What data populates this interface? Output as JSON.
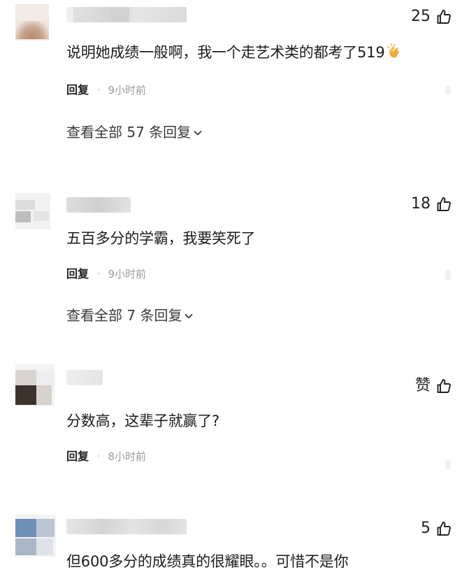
{
  "comments": [
    {
      "likes": "25",
      "text": "说明她成绩一般啊，我一个走艺术类的都考了519",
      "reply_label": "回复",
      "separator": "·",
      "time": "9小时前",
      "more_replies": "查看全部 57 条回复"
    },
    {
      "likes": "18",
      "text": "五百多分的学霸，我要笑死了",
      "reply_label": "回复",
      "separator": "·",
      "time": "9小时前",
      "more_replies": "查看全部 7 条回复"
    },
    {
      "likes": "赞",
      "text": "分数高，这辈子就赢了?",
      "reply_label": "回复",
      "separator": "·",
      "time": "8小时前"
    },
    {
      "likes": "5",
      "text": "但600多分的成绩真的很耀眼。。可惜不是你"
    }
  ],
  "icons": {
    "like": "thumbs-up-outline-icon",
    "expand": "chevron-down-icon",
    "emoji": "clapping-hands-emoji"
  },
  "colors": {
    "text": "#1c1c1c",
    "meta_time": "#9a9a9a",
    "more_replies": "#3a3a3a"
  }
}
